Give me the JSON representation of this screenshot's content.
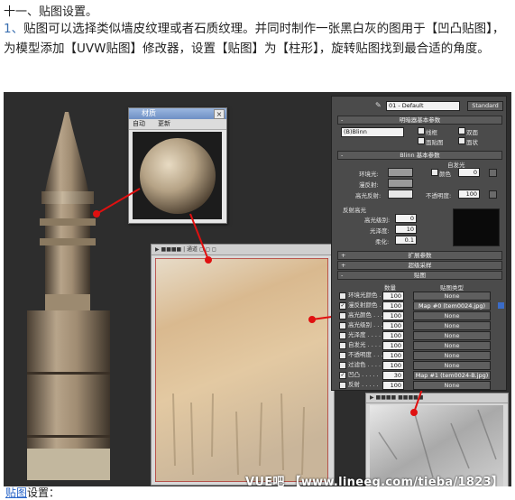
{
  "heading": "十一、贴图设置。",
  "intro": {
    "number": "1、",
    "text": "贴图可以选择类似墙皮纹理或者石质纹理。并同时制作一张黑白灰的图用于【凹凸贴图】，为模型添加【UVW贴图】修改器，设置【贴图】为【柱形】，旋转贴图找到最合适的角度。"
  },
  "material_window": {
    "title": "材质",
    "tab1": "自动",
    "tab2": "更新"
  },
  "texture_toolbar": "▶ ■■■■ | 通道 ◻ ◻ ◻",
  "bump_toolbar": "▶ ■■■■ ■■■■■",
  "panel": {
    "material_name": "01 - Default",
    "material_type": "Standard",
    "rollout_basic": "明暗器基本参数",
    "shader": "(B)Blinn",
    "wire": "线框",
    "two_sided": "双面",
    "face_map": "面贴图",
    "faceted": "面状",
    "rollout_blinn": "Blinn 基本参数",
    "self_illum": "自发光",
    "color_label": "颜色",
    "color_value": "0",
    "ambient": "环境光:",
    "diffuse": "漫反射:",
    "specular": "高光反射:",
    "opacity_label": "不透明度:",
    "opacity_value": "100",
    "spec_highlights": "反射高光",
    "spec_level": "高光级别:",
    "spec_level_value": "0",
    "glossiness": "光泽度:",
    "glossiness_value": "10",
    "soften": "柔化:",
    "soften_value": "0.1",
    "rollout_extended": "扩展参数",
    "rollout_supersampling": "超级采样",
    "rollout_maps": "贴图",
    "col_amount": "数量",
    "col_maptype": "贴图类型",
    "maps": [
      {
        "checked": false,
        "label": "环境光颜色 . .",
        "amount": "100",
        "map": "None"
      },
      {
        "checked": true,
        "label": "漫反射颜色 . .",
        "amount": "100",
        "map": "Map #0 (tem0024.jpg)"
      },
      {
        "checked": false,
        "label": "高光颜色 . . .",
        "amount": "100",
        "map": "None"
      },
      {
        "checked": false,
        "label": "高光级别 . . .",
        "amount": "100",
        "map": "None"
      },
      {
        "checked": false,
        "label": "光泽度 . . . .",
        "amount": "100",
        "map": "None"
      },
      {
        "checked": false,
        "label": "自发光 . . . .",
        "amount": "100",
        "map": "None"
      },
      {
        "checked": false,
        "label": "不透明度 . . .",
        "amount": "100",
        "map": "None"
      },
      {
        "checked": false,
        "label": "过滤色 . . . .",
        "amount": "100",
        "map": "None"
      },
      {
        "checked": true,
        "label": "凹凸 . . . . .",
        "amount": "30",
        "map": "Map #1 (tem0024-B.jpg)"
      },
      {
        "checked": false,
        "label": "反射 . . . . .",
        "amount": "100",
        "map": "None"
      }
    ]
  },
  "watermark": "VUE吧 【www.lineeg.com/tieba/1823】",
  "footer": {
    "link": "贴图",
    "text": "设置："
  }
}
